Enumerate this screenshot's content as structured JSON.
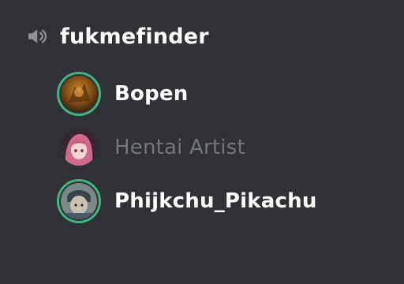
{
  "channel": {
    "name": "fukmefinder",
    "icon": "speaker-icon"
  },
  "users": [
    {
      "name": "Bopen",
      "speaking": true,
      "muted": false,
      "avatar_icon": "avatar-bopen"
    },
    {
      "name": "Hentai Artist",
      "speaking": false,
      "muted": true,
      "avatar_icon": "avatar-hentai-artist"
    },
    {
      "name": "Phijkchu_Pikachu",
      "speaking": true,
      "muted": false,
      "avatar_icon": "avatar-phijkchu-pikachu"
    }
  ],
  "colors": {
    "background": "#2f3136",
    "speaking_ring": "#43b581",
    "active_text": "#ffffff",
    "muted_text": "#72767d"
  }
}
